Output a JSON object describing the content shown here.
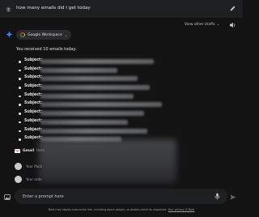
{
  "header": {
    "query": "how many emails did I get today"
  },
  "response": {
    "source_chip": "Google Workspace",
    "view_drafts": "View other drafts",
    "intro": "You received 10 emails today.",
    "subject_label": "Subject:",
    "subjects": [
      "Subject:",
      "Subject:",
      "Subject:",
      "Subject:",
      "Subject:",
      "Subject:",
      "Subject:",
      "Subject:",
      "Subject:",
      "Subject:"
    ],
    "gmail_label": "Gmail",
    "gmail_tail": "Item",
    "items": [
      "Your Pack",
      "Your orde"
    ]
  },
  "composer": {
    "placeholder": "Enter a prompt here"
  },
  "disclaimer": {
    "text": "Bard may display inaccurate info, including about people, so double-check its responses. ",
    "link": "Your privacy & Bard"
  },
  "colors": {
    "background": "#131314",
    "surface": "#1e1f20",
    "text": "#e3e3e3",
    "muted": "#9aa0a6",
    "accent": "#4285f4"
  }
}
